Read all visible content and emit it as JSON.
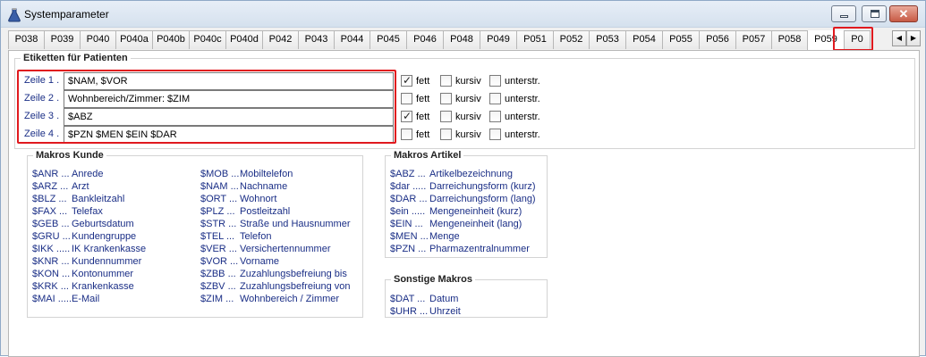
{
  "window": {
    "title": "Systemparameter"
  },
  "tabs": [
    "P038",
    "P039",
    "P040",
    "P040a",
    "P040b",
    "P040c",
    "P040d",
    "P042",
    "P043",
    "P044",
    "P045",
    "P046",
    "P048",
    "P049",
    "P051",
    "P052",
    "P053",
    "P054",
    "P055",
    "P056",
    "P057",
    "P058",
    "P059",
    "P0"
  ],
  "active_tab": "P059",
  "etiketten": {
    "legend": "Etiketten für Patienten",
    "rows": [
      {
        "label": "Zeile 1  .",
        "value": "$NAM, $VOR",
        "fett": true,
        "kursiv": false,
        "unterstr": false
      },
      {
        "label": "Zeile 2  .",
        "value": "Wohnbereich/Zimmer: $ZIM",
        "fett": false,
        "kursiv": false,
        "unterstr": false
      },
      {
        "label": "Zeile 3  .",
        "value": "$ABZ",
        "fett": true,
        "kursiv": false,
        "unterstr": false
      },
      {
        "label": "Zeile 4  .",
        "value": "$PZN $MEN $EIN $DAR",
        "fett": false,
        "kursiv": false,
        "unterstr": false
      }
    ],
    "fett_label": "fett",
    "kursiv_label": "kursiv",
    "unterstr_label": "unterstr."
  },
  "makros_kunde": {
    "legend": "Makros Kunde",
    "col1": [
      {
        "code": "$ANR ...",
        "desc": "Anrede"
      },
      {
        "code": "$ARZ ...",
        "desc": "Arzt"
      },
      {
        "code": "$BLZ ...",
        "desc": "Bankleitzahl"
      },
      {
        "code": "$FAX ...",
        "desc": "Telefax"
      },
      {
        "code": "$GEB ...",
        "desc": "Geburtsdatum"
      },
      {
        "code": "$GRU ...",
        "desc": "Kundengruppe"
      },
      {
        "code": "$IKK .....",
        "desc": "IK Krankenkasse"
      },
      {
        "code": "$KNR ...",
        "desc": "Kundennummer"
      },
      {
        "code": "$KON ...",
        "desc": "Kontonummer"
      },
      {
        "code": "$KRK ...",
        "desc": "Krankenkasse"
      },
      {
        "code": "$MAI .....",
        "desc": "E-Mail"
      }
    ],
    "col2": [
      {
        "code": "$MOB ...",
        "desc": "Mobiltelefon"
      },
      {
        "code": "$NAM ...",
        "desc": "Nachname"
      },
      {
        "code": "$ORT ...",
        "desc": "Wohnort"
      },
      {
        "code": "$PLZ ...",
        "desc": "Postleitzahl"
      },
      {
        "code": "$STR ...",
        "desc": "Straße und Hausnummer"
      },
      {
        "code": "$TEL ...",
        "desc": "Telefon"
      },
      {
        "code": "$VER ...",
        "desc": "Versichertennummer"
      },
      {
        "code": "$VOR ...",
        "desc": "Vorname"
      },
      {
        "code": "$ZBB ...",
        "desc": "Zuzahlungsbefreiung bis"
      },
      {
        "code": "$ZBV ...",
        "desc": "Zuzahlungsbefreiung von"
      },
      {
        "code": "$ZIM ...",
        "desc": "Wohnbereich / Zimmer"
      }
    ]
  },
  "makros_artikel": {
    "legend": "Makros Artikel",
    "items": [
      {
        "code": "$ABZ ...",
        "desc": "Artikelbezeichnung"
      },
      {
        "code": "$dar .....",
        "desc": "Darreichungsform (kurz)"
      },
      {
        "code": "$DAR ...",
        "desc": "Darreichungsform (lang)"
      },
      {
        "code": "$ein .....",
        "desc": "Mengeneinheit (kurz)"
      },
      {
        "code": "$EIN ...",
        "desc": "Mengeneinheit (lang)"
      },
      {
        "code": "$MEN ...",
        "desc": "Menge"
      },
      {
        "code": "$PZN ...",
        "desc": "Pharmazentralnummer"
      }
    ]
  },
  "sonstige_makros": {
    "legend": "Sonstige Makros",
    "items": [
      {
        "code": "$DAT ...",
        "desc": "Datum"
      },
      {
        "code": "$UHR ...",
        "desc": "Uhrzeit"
      }
    ]
  },
  "colors": {
    "label_blue": "#1a2e86",
    "highlight_red": "#e0191e"
  },
  "icons": {
    "app": "flask-icon",
    "minimize": "minimize-icon",
    "maximize": "maximize-icon",
    "close": "close-icon",
    "scroll_left": "arrow-left-icon",
    "scroll_right": "arrow-right-icon"
  }
}
